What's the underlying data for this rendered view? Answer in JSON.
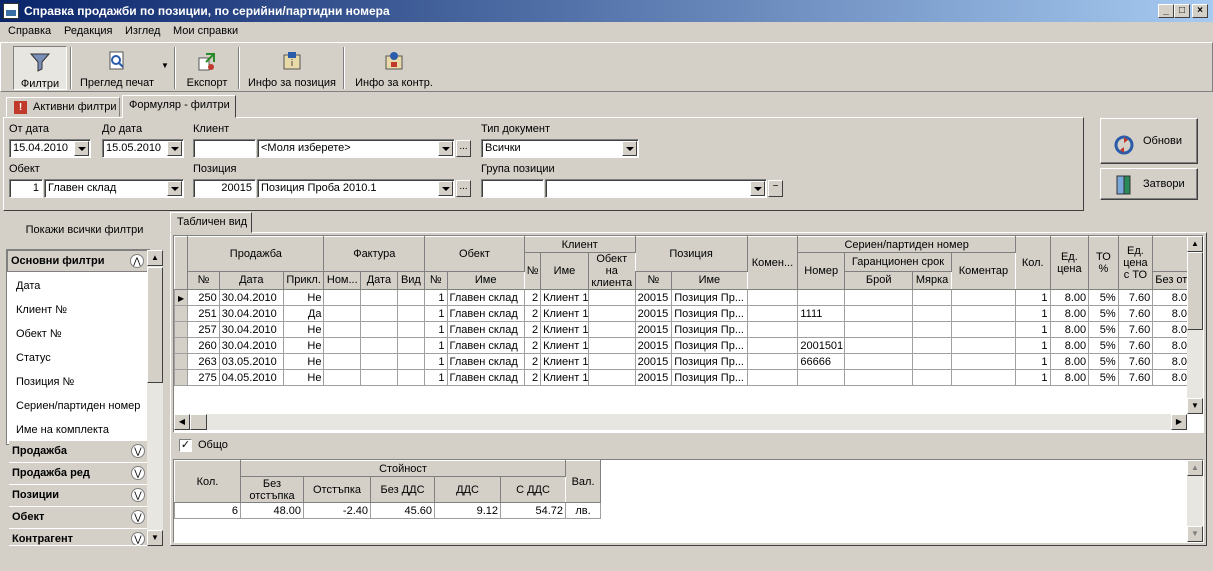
{
  "window": {
    "title": "Справка продажби по позиции, по серийни/партидни номера"
  },
  "menu": [
    "Справка",
    "Редакция",
    "Изглед",
    "Мои справки"
  ],
  "toolbar": {
    "filters": "Филтри",
    "print_preview": "Преглед печат",
    "export": "Експорт",
    "info_position": "Инфо за позиция",
    "info_contractor": "Инфо за контр."
  },
  "tabs": {
    "active_filters": "Активни филтри",
    "form_filters": "Формуляр - филтри"
  },
  "form": {
    "from_date_label": "От дата",
    "from_date": "15.04.2010",
    "to_date_label": "До дата",
    "to_date": "15.05.2010",
    "client_label": "Клиент",
    "client_code": "",
    "client_value": "<Моля изберете>",
    "doc_type_label": "Тип документ",
    "doc_type": "Всички",
    "object_label": "Обект",
    "object_code": "1",
    "object_value": "Главен склад",
    "position_label": "Позиция",
    "position_code": "20015",
    "position_value": "Позиция Проба 2010.1",
    "position_group_label": "Група позиции",
    "position_group_code": "",
    "position_group_value": ""
  },
  "buttons": {
    "refresh": "Обнови",
    "close": "Затвори",
    "show_all_filters": "Покажи всички филтри",
    "ellipsis": "...",
    "minus": "−"
  },
  "filters_panel": {
    "basic_group": "Основни филтри",
    "items": [
      "Дата",
      "Клиент №",
      "Обект №",
      "Статус",
      "Позиция №",
      "Сериен/партиден номер",
      "Име на комплекта"
    ],
    "groups": [
      "Продажба",
      "Продажба ред",
      "Позиции",
      "Обект",
      "Контрагент"
    ]
  },
  "grid_tab": "Табличен вид",
  "grid": {
    "group_headers": {
      "sale": "Продажба",
      "invoice": "Фактура",
      "object": "Обект",
      "client": "Клиент",
      "position": "Позиция",
      "comment": "Комен...",
      "serial": "Сериен/партиден номер",
      "qty": "Кол.",
      "unit_price": "Ед. цена",
      "to_pct": "ТО %",
      "unit_price_to": "Ед. цена с ТО",
      "without_discount": "Без отстъп"
    },
    "sub_headers": {
      "no": "№",
      "date": "Дата",
      "attached": "Прикл.",
      "inv_no": "Ном...",
      "inv_date": "Дата",
      "inv_type": "Вид",
      "obj_no": "№",
      "obj_name": "Име",
      "cl_no": "№",
      "cl_name": "Име",
      "cl_object": "Обект на клиента",
      "pos_no": "№",
      "pos_name": "Име",
      "serial_no": "Номер",
      "warranty": "Гаранционен срок",
      "w_count": "Брой",
      "w_measure": "Мярка",
      "serial_comment": "Коментар"
    },
    "rows": [
      {
        "no": "250",
        "date": "30.04.2010",
        "att": "Не",
        "obj_no": "1",
        "obj_name": "Главен склад",
        "cl_no": "2",
        "cl_name": "Клиент 1",
        "pos_no": "20015",
        "pos_name": "Позиция Пр...",
        "serial": "",
        "qty": "1",
        "price": "8.00",
        "to": "5%",
        "price_to": "7.60",
        "wd": "8.0"
      },
      {
        "no": "251",
        "date": "30.04.2010",
        "att": "Да",
        "obj_no": "1",
        "obj_name": "Главен склад",
        "cl_no": "2",
        "cl_name": "Клиент 1",
        "pos_no": "20015",
        "pos_name": "Позиция Пр...",
        "serial": "1111",
        "qty": "1",
        "price": "8.00",
        "to": "5%",
        "price_to": "7.60",
        "wd": "8.0"
      },
      {
        "no": "257",
        "date": "30.04.2010",
        "att": "Не",
        "obj_no": "1",
        "obj_name": "Главен склад",
        "cl_no": "2",
        "cl_name": "Клиент 1",
        "pos_no": "20015",
        "pos_name": "Позиция Пр...",
        "serial": "",
        "qty": "1",
        "price": "8.00",
        "to": "5%",
        "price_to": "7.60",
        "wd": "8.0"
      },
      {
        "no": "260",
        "date": "30.04.2010",
        "att": "Не",
        "obj_no": "1",
        "obj_name": "Главен склад",
        "cl_no": "2",
        "cl_name": "Клиент 1",
        "pos_no": "20015",
        "pos_name": "Позиция Пр...",
        "serial": "2001501",
        "qty": "1",
        "price": "8.00",
        "to": "5%",
        "price_to": "7.60",
        "wd": "8.0"
      },
      {
        "no": "263",
        "date": "03.05.2010",
        "att": "Не",
        "obj_no": "1",
        "obj_name": "Главен склад",
        "cl_no": "2",
        "cl_name": "Клиент 1",
        "pos_no": "20015",
        "pos_name": "Позиция Пр...",
        "serial": "66666",
        "qty": "1",
        "price": "8.00",
        "to": "5%",
        "price_to": "7.60",
        "wd": "8.0"
      },
      {
        "no": "275",
        "date": "04.05.2010",
        "att": "Не",
        "obj_no": "1",
        "obj_name": "Главен склад",
        "cl_no": "2",
        "cl_name": "Клиент 1",
        "pos_no": "20015",
        "pos_name": "Позиция Пр...",
        "serial": "",
        "qty": "1",
        "price": "8.00",
        "to": "5%",
        "price_to": "7.60",
        "wd": "8.0"
      }
    ]
  },
  "totals": {
    "checkbox_label": "Общо",
    "headers": {
      "qty": "Кол.",
      "value": "Стойност",
      "without_discount": "Без отстъпка",
      "discount": "Отстъпка",
      "without_vat": "Без ДДС",
      "vat": "ДДС",
      "with_vat": "С ДДС",
      "currency": "Вал."
    },
    "row": {
      "qty": "6",
      "without_discount": "48.00",
      "discount": "-2.40",
      "without_vat": "45.60",
      "vat": "9.12",
      "with_vat": "54.72",
      "currency": "лв."
    }
  }
}
